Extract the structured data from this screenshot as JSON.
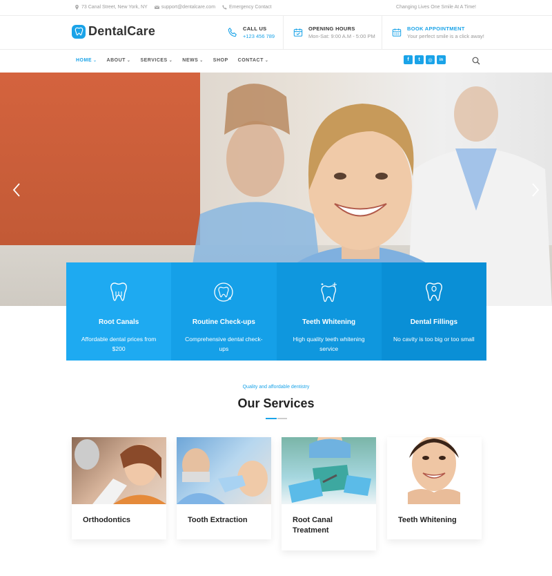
{
  "topbar": {
    "address": "73 Canal Street, New York, NY",
    "email": "support@dentalcare.com",
    "emergency": "Emergency Contact",
    "tagline": "Changing Lives One Smile At A Time!"
  },
  "brand": {
    "name": "DentalCare"
  },
  "header": {
    "call": {
      "title": "CALL US",
      "value": "+123 456 789"
    },
    "hours": {
      "title": "OPENING HOURS",
      "value": "Mon-Sat: 9:00 A.M - 5:00 PM"
    },
    "appointment": {
      "title": "BOOK APPOINTMENT",
      "value": "Your perfect smile is a click away!"
    }
  },
  "nav": {
    "items": [
      {
        "label": "HOME",
        "caret": "⌄",
        "active": true
      },
      {
        "label": "ABOUT",
        "caret": "⌄"
      },
      {
        "label": "SERVICES",
        "caret": "⌄"
      },
      {
        "label": "NEWS",
        "caret": "⌄"
      },
      {
        "label": "SHOP",
        "caret": ""
      },
      {
        "label": "CONTACT",
        "caret": "⌄"
      }
    ],
    "social": [
      "f",
      "t",
      "◎",
      "in"
    ],
    "social_icons": [
      "facebook-icon",
      "twitter-icon",
      "instagram-icon",
      "linkedin-icon"
    ]
  },
  "features": [
    {
      "title": "Root Canals",
      "desc": "Affordable dental prices from $200",
      "color": "#1eaaf1"
    },
    {
      "title": "Routine Check-ups",
      "desc": "Comprehensive dental check-ups",
      "color": "#15a0e8"
    },
    {
      "title": "Teeth Whitening",
      "desc": "High quality teeth whitening service",
      "color": "#0f97de"
    },
    {
      "title": "Dental Fillings",
      "desc": "No cavity is too big or too small",
      "color": "#0a8fd6"
    }
  ],
  "services": {
    "subtitle": "Quality and affordable dentistry",
    "title": "Our Services",
    "cards": [
      {
        "title": "Orthodontics"
      },
      {
        "title": "Tooth Extraction"
      },
      {
        "title": "Root Canal Treatment"
      },
      {
        "title": "Teeth Whitening"
      }
    ]
  },
  "colors": {
    "accent": "#1aa3e8",
    "text": "#222222",
    "muted": "#9a9a9a"
  }
}
